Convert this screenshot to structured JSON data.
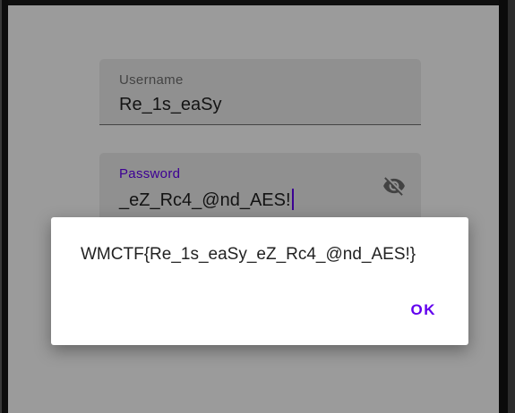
{
  "login_form": {
    "username": {
      "label": "Username",
      "value": "Re_1s_eaSy"
    },
    "password": {
      "label": "Password",
      "value": "_eZ_Rc4_@nd_AES!",
      "toggle_icon": "visibility-off-icon"
    }
  },
  "dialog": {
    "message": "WMCTF{Re_1s_eaSy_eZ_Rc4_@nd_AES!}",
    "ok_label": "OK"
  },
  "colors": {
    "accent": "#6200ee",
    "field_background": "#e9e9e9",
    "scrim": "rgba(0,0,0,0.38)"
  }
}
